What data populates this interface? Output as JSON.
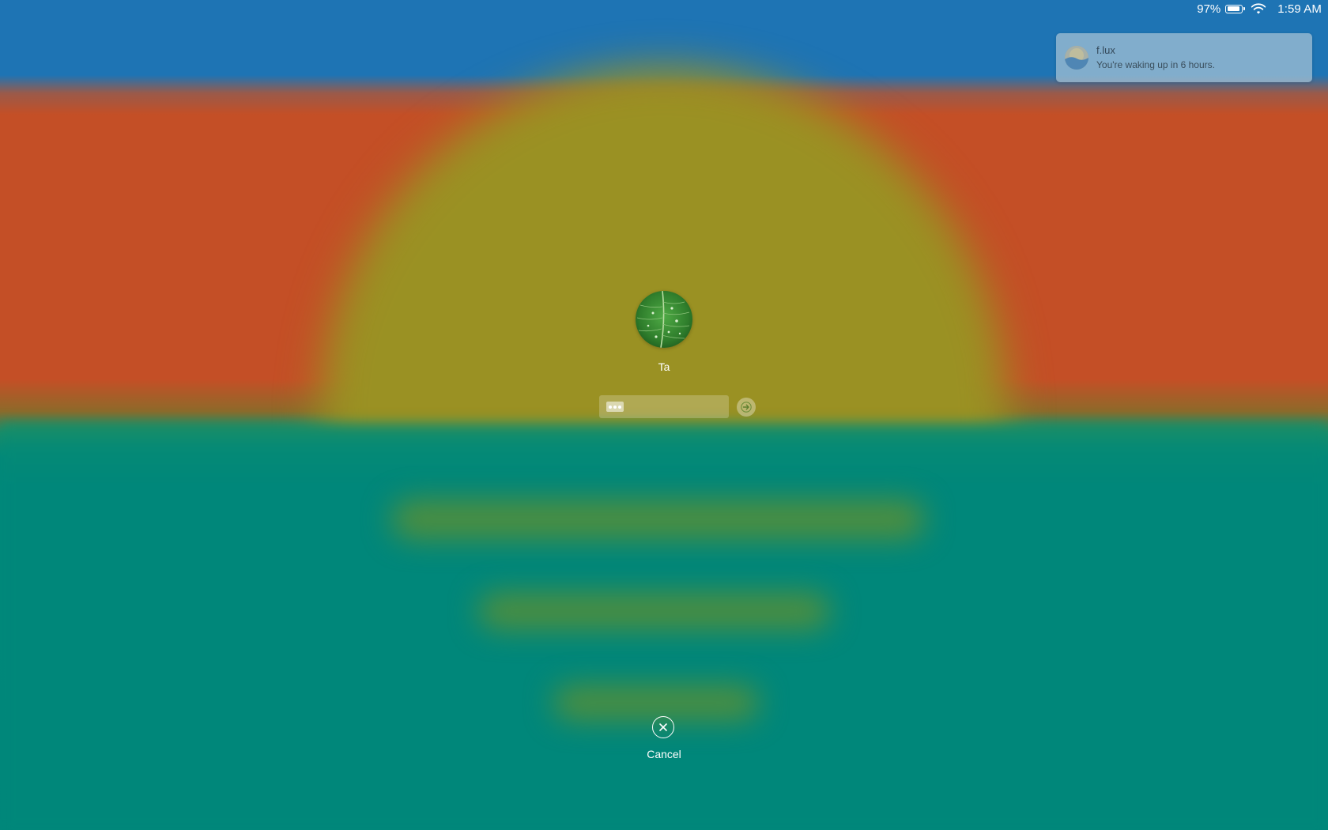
{
  "menubar": {
    "battery_percent": "97%",
    "battery_icon": "battery-icon",
    "wifi_icon": "wifi-icon",
    "clock": "1:59 AM"
  },
  "notification": {
    "app_name": "f.lux",
    "message": "You're waking up in 6 hours.",
    "icon": "flux-app-icon"
  },
  "login": {
    "username": "Ta",
    "avatar": "leaf-avatar",
    "password_masked": "•••",
    "submit_icon": "arrow-right-icon"
  },
  "cancel": {
    "label": "Cancel",
    "icon": "close-circle-icon"
  },
  "colors": {
    "sky": "#1e74b4",
    "sunset_band": "#c44f26",
    "sun": "#9a9123",
    "sea": "#00877a",
    "reflection": "#4e8e3e"
  }
}
